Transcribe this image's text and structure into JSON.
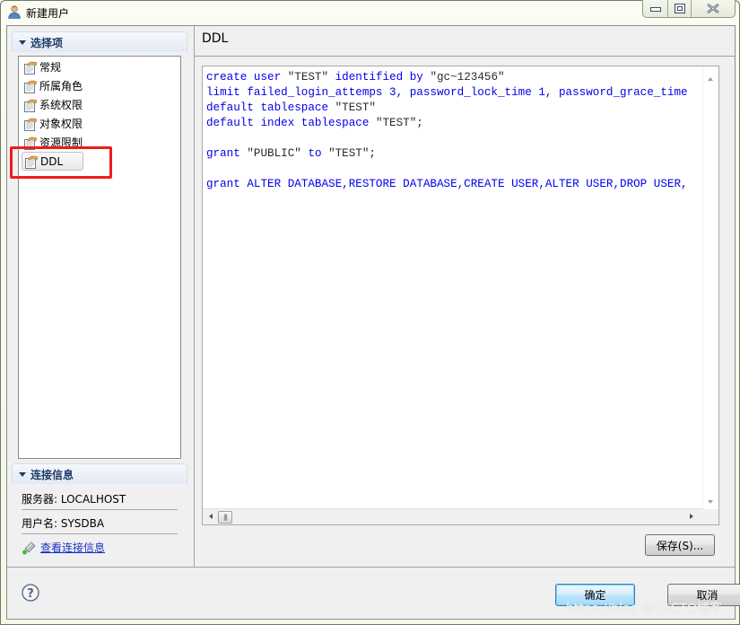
{
  "window": {
    "title": "新建用户",
    "controls": {
      "minimize": "minimize",
      "maximize": "maximize",
      "close": "close"
    }
  },
  "left_pane": {
    "selection_section": {
      "header": "选择项",
      "items": [
        {
          "label": "常规",
          "icon": "page-hand-icon"
        },
        {
          "label": "所属角色",
          "icon": "page-hand-icon"
        },
        {
          "label": "系统权限",
          "icon": "page-hand-icon"
        },
        {
          "label": "对象权限",
          "icon": "page-hand-icon"
        },
        {
          "label": "资源限制",
          "icon": "page-hand-icon"
        },
        {
          "label": "DDL",
          "icon": "page-hand-icon",
          "selected": true
        }
      ]
    },
    "connection_section": {
      "header": "连接信息",
      "server": "服务器: LOCALHOST",
      "username": "用户名: SYSDBA",
      "view_link": "查看连接信息"
    }
  },
  "right_pane": {
    "page_title": "DDL",
    "ddl_lines": [
      [
        {
          "t": "create user ",
          "k": 1
        },
        {
          "t": "\"TEST\"",
          "k": 0
        },
        {
          "t": " identified by ",
          "k": 1
        },
        {
          "t": "\"gc~123456\"",
          "k": 0
        }
      ],
      [
        {
          "t": "limit failed_login_attemps 3, password_lock_time 1, password_grace_time",
          "k": 1
        }
      ],
      [
        {
          "t": "default tablespace ",
          "k": 1
        },
        {
          "t": "\"TEST\"",
          "k": 0
        }
      ],
      [
        {
          "t": "default index tablespace ",
          "k": 1
        },
        {
          "t": "\"TEST\";",
          "k": 0
        }
      ],
      [],
      [
        {
          "t": "grant ",
          "k": 1
        },
        {
          "t": "\"PUBLIC\"",
          "k": 0
        },
        {
          "t": " to ",
          "k": 1
        },
        {
          "t": "\"TEST\";",
          "k": 0
        }
      ],
      [],
      [
        {
          "t": "grant ALTER DATABASE,RESTORE DATABASE,CREATE USER,ALTER USER,DROP USER,",
          "k": 1
        }
      ]
    ],
    "save_button": "保存(S)..."
  },
  "footer": {
    "ok_button": "确定",
    "cancel_button": "取消",
    "watermark": "https://blog.@51CTO博客"
  },
  "colors": {
    "keyword": "#0000ee",
    "string": "#2a2a2a",
    "link": "#1a31c2",
    "highlight": "#ee1c1c"
  }
}
